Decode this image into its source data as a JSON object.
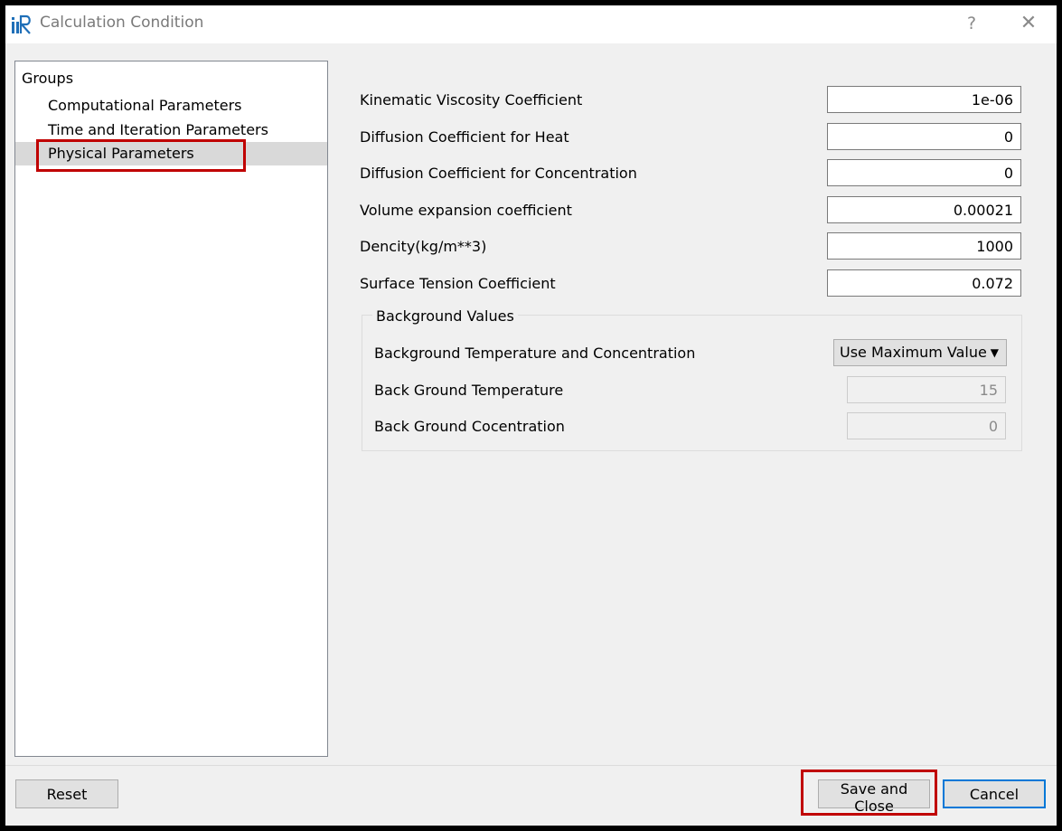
{
  "window": {
    "title": "Calculation Condition",
    "help_label": "?",
    "close_label": "✕"
  },
  "groups": {
    "header": "Groups",
    "items": [
      {
        "label": "Computational Parameters"
      },
      {
        "label": "Time and Iteration Parameters"
      },
      {
        "label": "Physical Parameters",
        "selected": true
      }
    ]
  },
  "fields": [
    {
      "label": "Kinematic Viscosity Coefficient",
      "value": "1e-06"
    },
    {
      "label": "Diffusion Coefficient for Heat",
      "value": "0"
    },
    {
      "label": "Diffusion Coefficient for Concentration",
      "value": "0"
    },
    {
      "label": "Volume expansion coefficient",
      "value": "0.00021"
    },
    {
      "label": "Dencity(kg/m**3)",
      "value": "1000"
    },
    {
      "label": "Surface Tension Coefficient",
      "value": "0.072"
    }
  ],
  "background": {
    "title": "Background Values",
    "mode_label": "Background Temperature and Concentration",
    "mode_value": "Use Maximum Value",
    "temperature_label": "Back Ground Temperature",
    "temperature_value": "15",
    "concentration_label": "Back Ground Cocentration",
    "concentration_value": "0"
  },
  "buttons": {
    "reset": "Reset",
    "save_close": "Save and Close",
    "cancel": "Cancel"
  },
  "colors": {
    "highlight": "#c00000",
    "default_button_border": "#0078d7",
    "app_icon": "#1f6fb8"
  }
}
